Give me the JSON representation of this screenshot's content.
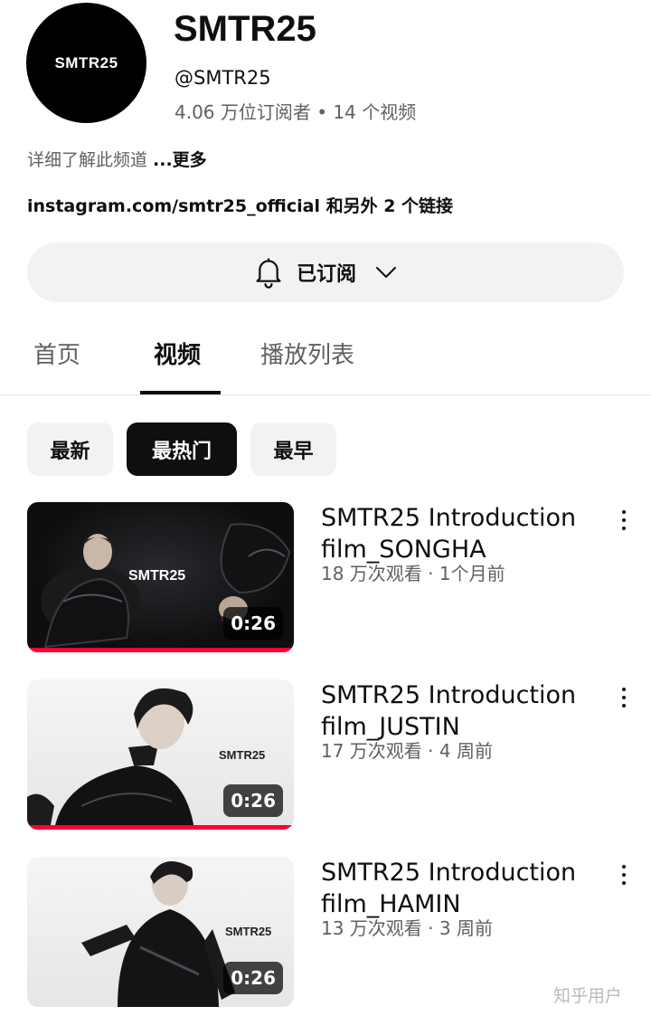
{
  "channel": {
    "avatar_text": "SMTR25",
    "name": "SMTR25",
    "handle": "@SMTR25",
    "stats": "4.06 万位订阅者 • 14 个视频",
    "about": "详细了解此频道",
    "about_more": "...更多",
    "links": "instagram.com/smtr25_official 和另外 2 个链接"
  },
  "subscribe": {
    "label": "已订阅",
    "icon": "bell-icon",
    "dropdown_icon": "chevron-down-icon"
  },
  "tabs": [
    {
      "label": "首页",
      "active": false
    },
    {
      "label": "视频",
      "active": true
    },
    {
      "label": "播放列表",
      "active": false
    }
  ],
  "sort_chips": [
    {
      "label": "最新",
      "active": false
    },
    {
      "label": "最热门",
      "active": true
    },
    {
      "label": "最早",
      "active": false
    }
  ],
  "videos": [
    {
      "title": "SMTR25 Introduction film_SONGHA",
      "meta": "18 万次观看 · 1个月前",
      "duration": "0:26",
      "thumb_logo": "SMTR25"
    },
    {
      "title": "SMTR25 Introduction film_JUSTIN",
      "meta": "17 万次观看 · 4 周前",
      "duration": "0:26",
      "thumb_logo": "SMTR25"
    },
    {
      "title": "SMTR25 Introduction film_HAMIN",
      "meta": "13 万次观看 · 3 周前",
      "duration": "0:26",
      "thumb_logo": "SMTR25"
    }
  ],
  "watermark": "知乎用户",
  "colors": {
    "accent": "#ff0033",
    "text_primary": "#0f0f0f",
    "text_secondary": "#606060",
    "chip_bg": "#f2f2f2"
  }
}
